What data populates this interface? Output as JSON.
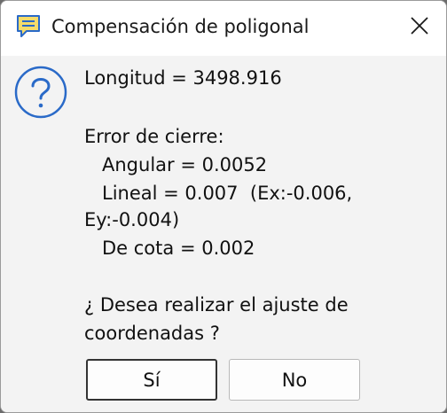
{
  "window": {
    "title": "Compensación de poligonal",
    "app_icon": "comment-lines-icon",
    "close_icon": "close-icon"
  },
  "dialog": {
    "icon": "question-circle-icon",
    "longitud": "Longitud = 3498.916",
    "error_heading": "Error de cierre:",
    "angular": "Angular = 0.0052",
    "lineal": "Lineal = 0.007  (Ex:-0.006,",
    "lineal_cont": "Ey:-0.004)",
    "cota": "De cota = 0.002",
    "question_line1": "¿ Desea realizar el ajuste de",
    "question_line2": "coordenadas ?"
  },
  "buttons": {
    "yes": "Sí",
    "no": "No"
  },
  "colors": {
    "icon_blue": "#2a6ac8",
    "title_icon_yellow": "#f6dc6a"
  }
}
